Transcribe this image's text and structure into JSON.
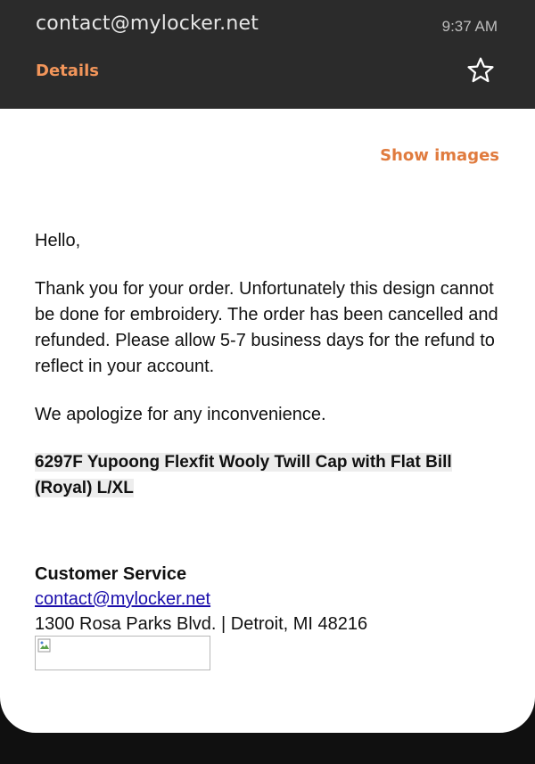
{
  "header": {
    "from": "contact@mylocker.net",
    "time": "9:37 AM",
    "details_label": "Details",
    "star_icon": "star-outline-icon"
  },
  "toolbar": {
    "show_images_label": "Show images"
  },
  "email": {
    "greeting": "Hello,",
    "paragraph1": "Thank you for your order. Unfortunately this design cannot be done for embroidery. The order has been cancelled and refunded. Please allow 5-7 business days for the refund to reflect in your account.",
    "paragraph2": "We apologize for any inconvenience.",
    "product_line1": "6297F Yupoong Flexfit Wooly Twill Cap with Flat Bill",
    "product_line2": "(Royal) L/XL",
    "signature": {
      "name": "Customer Service",
      "email": "contact@mylocker.net",
      "address": "1300 Rosa Parks Blvd. | Detroit, MI 48216"
    }
  },
  "colors": {
    "header_bg": "#2b2b2b",
    "accent": "#f2955a",
    "link": "#1a0dab"
  }
}
